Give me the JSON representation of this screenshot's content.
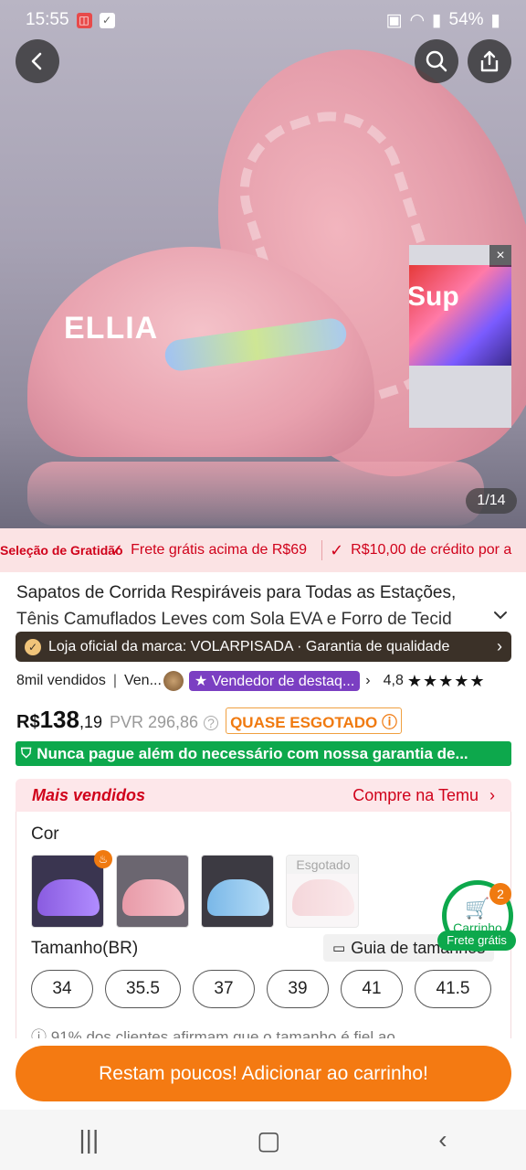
{
  "status_bar": {
    "time": "15:55",
    "battery": "54%"
  },
  "hero": {
    "image_counter": "1/14",
    "brand_print": "ELLIA",
    "video_text": "Sup",
    "video_close": "×"
  },
  "benefits": {
    "promo": "Seleção de Gratidão",
    "items": [
      "Frete grátis acima de R$69",
      "R$10,00 de crédito por a"
    ]
  },
  "product": {
    "title_line1": "Sapatos de Corrida Respiráveis para Todas as Estações,",
    "title_line2": "Tênis Camuflados Leves com Sola EVA e Forro de Tecid"
  },
  "brand_bar": {
    "text": "Loja oficial da marca: VOLARPISADA · Garantia de qualidade"
  },
  "sales": {
    "sold": "8mil vendidos",
    "vendor": "Ven...",
    "badge": "Vendedor de destaq...",
    "rating": "4,8",
    "stars": "★★★★★"
  },
  "price": {
    "currency": "R$",
    "integer": "138",
    "decimal": ",19",
    "rrp": "PVR 296,86",
    "low_stock": "QUASE ESGOTADO"
  },
  "guarantee": {
    "text": "Nunca pague além do necessário com nossa garantia de..."
  },
  "bestseller": {
    "left": "Mais vendidos",
    "right": "Compre na Temu"
  },
  "options": {
    "color_label": "Cor",
    "sold_out": "Esgotado",
    "size_label": "Tamanho(BR)",
    "size_guide": "Guia de tamanhos",
    "sizes": [
      "34",
      "35.5",
      "37",
      "39",
      "41",
      "41.5"
    ],
    "fit_note": "91% dos clientes afirmam que o tamanho é fiel ao"
  },
  "cart": {
    "label": "Carrinho",
    "count": "2",
    "free_shipping": "Frete grátis"
  },
  "cta": {
    "label": "Restam poucos! Adicionar ao carrinho!"
  },
  "colors": {
    "accent_red": "#d0021b",
    "cta_orange": "#f47a12",
    "guarantee_green": "#0da84c",
    "badge_purple": "#7b3fc2"
  }
}
